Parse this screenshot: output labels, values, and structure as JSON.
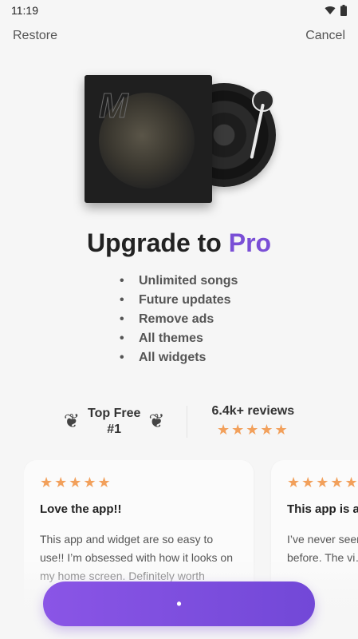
{
  "status_bar": {
    "time": "11:19",
    "wifi_icon": "wifi-icon",
    "battery_icon": "battery-icon"
  },
  "top_actions": {
    "restore": "Restore",
    "cancel": "Cancel"
  },
  "hero": {
    "album_letter": "M",
    "icon": "vinyl-record-icon"
  },
  "title": {
    "prefix": "Upgrade to",
    "highlight": "Pro",
    "highlight_color": "#7a4fd6"
  },
  "features": [
    "Unlimited songs",
    "Future updates",
    "Remove ads",
    "All themes",
    "All widgets"
  ],
  "stats": {
    "rank_line1": "Top Free",
    "rank_line2": "#1",
    "laurel_icon": "laurel-icon",
    "reviews_label": "6.4k+ reviews",
    "stars": "★★★★★",
    "star_color": "#f2a05b"
  },
  "reviews": [
    {
      "stars": "★★★★★",
      "title": "Love the app!!",
      "text": "This app and widget are so easy to use!! I’m obsessed with how it looks on my home screen. Definitely worth"
    },
    {
      "stars": "★★★★★",
      "title": "This app is a",
      "text": "I’ve never seen something like this before. The vi… een an optio…"
    }
  ],
  "cta": {
    "label": "•",
    "gradient_start": "#8a55e6",
    "gradient_end": "#7248d7"
  }
}
